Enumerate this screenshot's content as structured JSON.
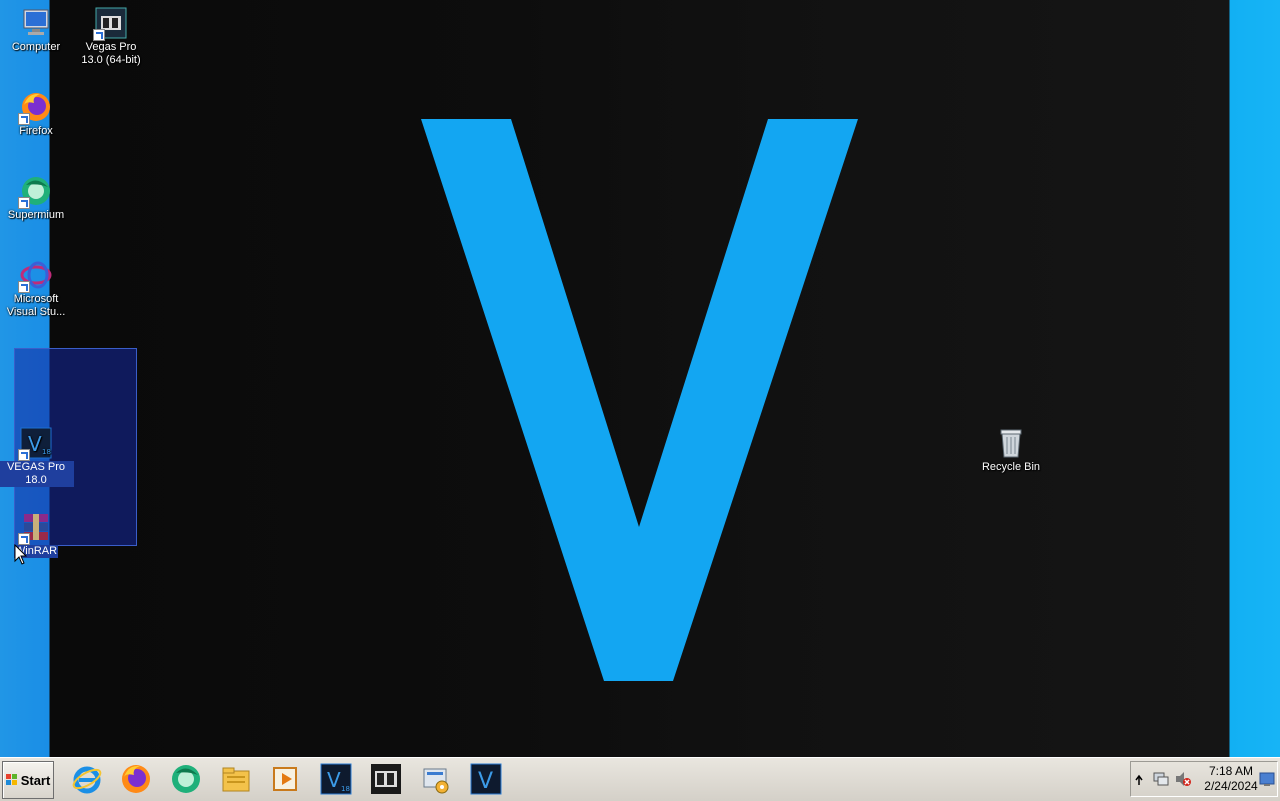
{
  "desktop": {
    "icons": [
      {
        "label": "Computer"
      },
      {
        "label": "Vegas Pro 13.0 (64-bit)"
      },
      {
        "label": "Firefox"
      },
      {
        "label": "Supermium"
      },
      {
        "label": "Microsoft Visual Stu..."
      },
      {
        "label": "VEGAS Pro 18.0"
      },
      {
        "label": "WinRAR"
      },
      {
        "label": "Recycle Bin"
      }
    ],
    "wallpaper_color": "#13a6f2"
  },
  "taskbar": {
    "start_label": "Start",
    "pinned": [
      {
        "icon": "internet-explorer-icon"
      },
      {
        "icon": "firefox-icon"
      },
      {
        "icon": "supermium-icon"
      },
      {
        "icon": "file-explorer-icon"
      },
      {
        "icon": "media-player-icon"
      },
      {
        "icon": "vegas-pro-18-icon"
      },
      {
        "icon": "vegas-pro-13-icon"
      },
      {
        "icon": "control-panel-icon"
      },
      {
        "icon": "vegas-icon"
      }
    ],
    "clock": {
      "time": "7:18 AM",
      "date": "2/24/2024"
    }
  }
}
